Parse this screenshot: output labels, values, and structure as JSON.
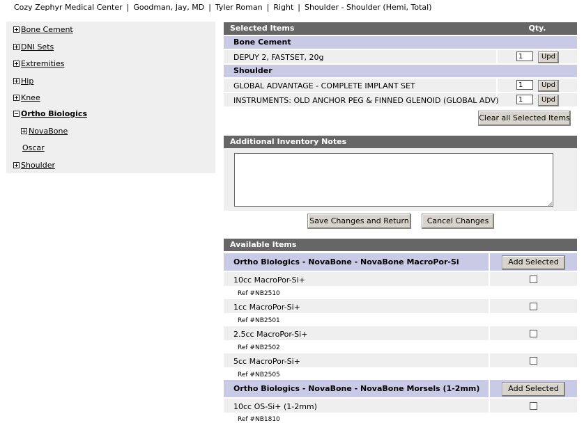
{
  "breadcrumb": {
    "parts": [
      "Cozy Zephyr Medical Center",
      "Goodman, Jay, MD",
      "Tyler Roman",
      "Right",
      "Shoulder - Shoulder (Hemi, Total)"
    ],
    "separator": "|"
  },
  "tree": {
    "items": [
      {
        "label": "Bone Cement",
        "expanded": false
      },
      {
        "label": "DNI Sets",
        "expanded": false
      },
      {
        "label": "Extremities",
        "expanded": false
      },
      {
        "label": "Hip",
        "expanded": false
      },
      {
        "label": "Knee",
        "expanded": false
      },
      {
        "label": "Ortho Biologics",
        "expanded": true
      },
      {
        "label": "NovaBone",
        "expanded": false
      },
      {
        "label": "Oscar"
      },
      {
        "label": "Shoulder",
        "expanded": false
      }
    ]
  },
  "selected": {
    "header": "Selected Items",
    "qty_header": "Qty.",
    "groups": [
      {
        "name": "Bone Cement",
        "items": [
          {
            "label": "DEPUY 2, FASTSET, 20g",
            "qty": "1"
          }
        ]
      },
      {
        "name": "Shoulder",
        "items": [
          {
            "label": "GLOBAL ADVANTAGE - COMPLETE IMPLANT SET",
            "qty": "1"
          },
          {
            "label": "INSTRUMENTS: OLD ANCHOR PEG & FINNED GLENOID (GLOBAL ADV)",
            "qty": "1"
          }
        ]
      }
    ],
    "upd_label": "Upd",
    "clear_label": "Clear all Selected Items"
  },
  "notes": {
    "header": "Additional Inventory Notes",
    "value": "",
    "save_label": "Save Changes and Return",
    "cancel_label": "Cancel Changes"
  },
  "available": {
    "header": "Available Items",
    "add_label": "Add Selected",
    "groups": [
      {
        "name": "Ortho Biologics - NovaBone - NovaBone MacroPor-Si",
        "items": [
          {
            "label": "10cc MacroPor-Si+",
            "ref": "Ref #NB2510"
          },
          {
            "label": "1cc MacroPor-Si+",
            "ref": "Ref #NB2501"
          },
          {
            "label": "2.5cc MacroPor-Si+",
            "ref": "Ref #NB2502"
          },
          {
            "label": "5cc MacroPor-Si+",
            "ref": "Ref #NB2505"
          }
        ]
      },
      {
        "name": "Ortho Biologics - NovaBone - NovaBone Morsels (1-2mm)",
        "items": [
          {
            "label": "10cc OS-Si+ (1-2mm)",
            "ref": "Ref #NB1810"
          }
        ]
      }
    ]
  }
}
